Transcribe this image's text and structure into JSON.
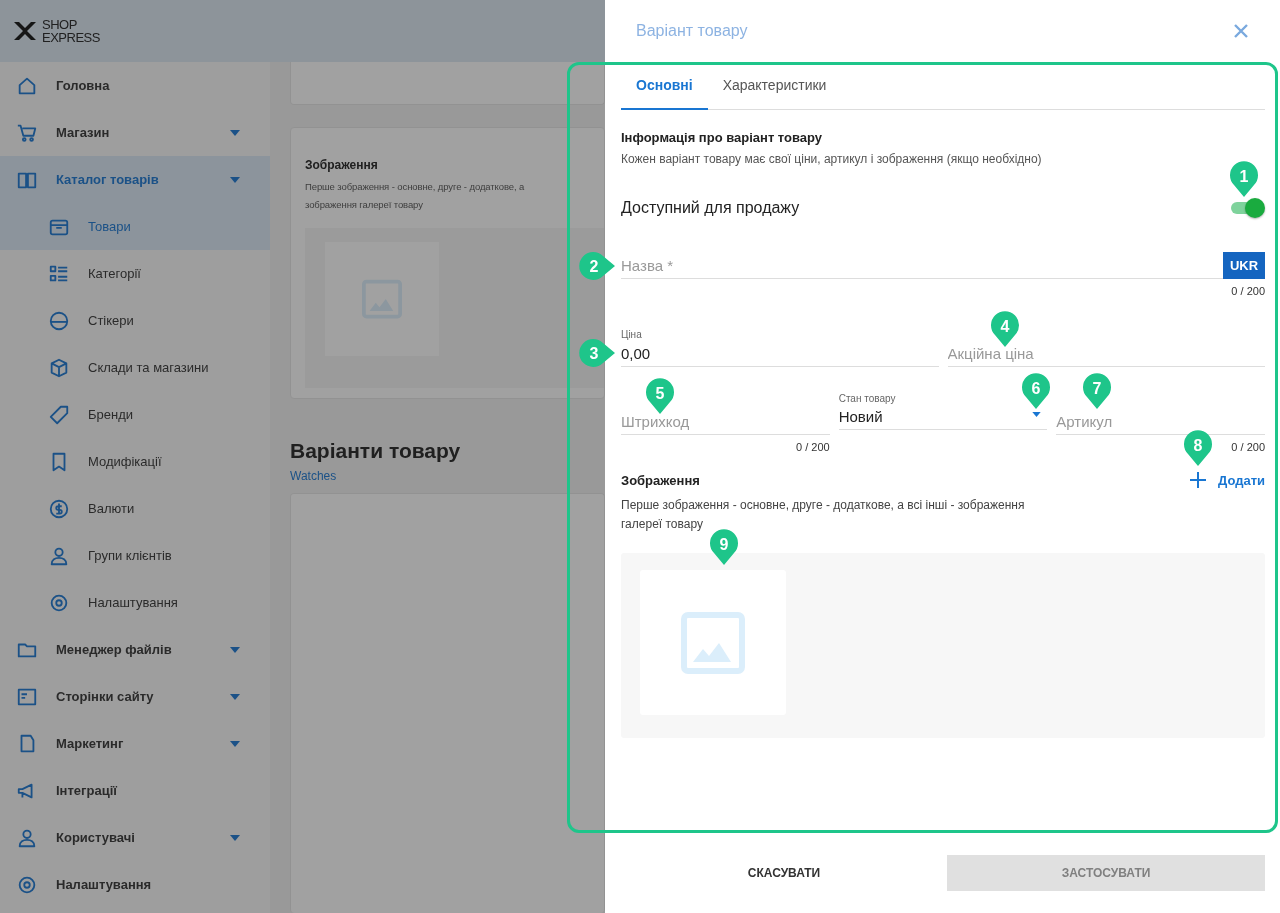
{
  "logo": {
    "line1": "SHOP",
    "line2": "EXPRESS"
  },
  "sidebar": {
    "items": [
      {
        "label": "Головна",
        "expandable": false,
        "selected": false
      },
      {
        "label": "Магазин",
        "expandable": true,
        "selected": false
      },
      {
        "label": "Каталог товарів",
        "expandable": true,
        "selected": true,
        "children": [
          {
            "label": "Товари",
            "selected": true
          },
          {
            "label": "Категорії",
            "selected": false
          },
          {
            "label": "Стікери",
            "selected": false
          },
          {
            "label": "Склади та магазини",
            "selected": false
          },
          {
            "label": "Бренди",
            "selected": false
          },
          {
            "label": "Модифікації",
            "selected": false
          },
          {
            "label": "Валюти",
            "selected": false
          },
          {
            "label": "Групи клієнтів",
            "selected": false
          },
          {
            "label": "Налаштування",
            "selected": false
          }
        ]
      },
      {
        "label": "Менеджер файлів",
        "expandable": true,
        "selected": false
      },
      {
        "label": "Сторінки сайту",
        "expandable": true,
        "selected": false
      },
      {
        "label": "Маркетинг",
        "expandable": true,
        "selected": false
      },
      {
        "label": "Інтеграції",
        "expandable": false,
        "selected": false
      },
      {
        "label": "Користувачі",
        "expandable": true,
        "selected": false
      },
      {
        "label": "Налаштування",
        "expandable": false,
        "selected": false
      }
    ]
  },
  "main": {
    "images_card": {
      "title": "Зображення",
      "description_lines": [
        "Перше зображення - основне, друге - додаткове, а",
        "зображення галереї товару"
      ]
    },
    "variants": {
      "title": "Варіанти товару",
      "link": "Watches"
    }
  },
  "drawer": {
    "title": "Варіант товару",
    "tabs": [
      {
        "label": "Основні",
        "selected": true
      },
      {
        "label": "Характеристики",
        "selected": false
      }
    ],
    "info": {
      "title": "Інформація про варіант товару",
      "subtitle": "Кожен варіант товару має свої ціни, артикул і зображення (якщо необхідно)"
    },
    "available": {
      "label": "Доступний для продажу",
      "on": true
    },
    "name_field": {
      "placeholder": "Назва *",
      "language": "UKR",
      "counter": "0 / 200"
    },
    "price": {
      "label": "Ціна",
      "value": "0,00"
    },
    "sale_price": {
      "placeholder": "Акційна ціна"
    },
    "barcode": {
      "placeholder": "Штрихкод",
      "counter": "0 / 200"
    },
    "condition": {
      "label": "Стан товару",
      "value": "Новий"
    },
    "sku": {
      "placeholder": "Артикул",
      "counter": "0 / 200"
    },
    "images": {
      "title": "Зображення",
      "add": "Додати",
      "description": "Перше зображення - основне, друге - додаткове, а всі інші - зображення галереї товару"
    },
    "footer": {
      "cancel": "СКАСУВАТИ",
      "apply": {
        "label": "ЗАСТОСУВАТИ",
        "disabled": true
      }
    }
  },
  "annotations": [
    {
      "label": "1"
    },
    {
      "label": "2"
    },
    {
      "label": "3"
    },
    {
      "label": "4"
    },
    {
      "label": "5"
    },
    {
      "label": "6"
    },
    {
      "label": "7"
    },
    {
      "label": "8"
    },
    {
      "label": "9"
    }
  ]
}
